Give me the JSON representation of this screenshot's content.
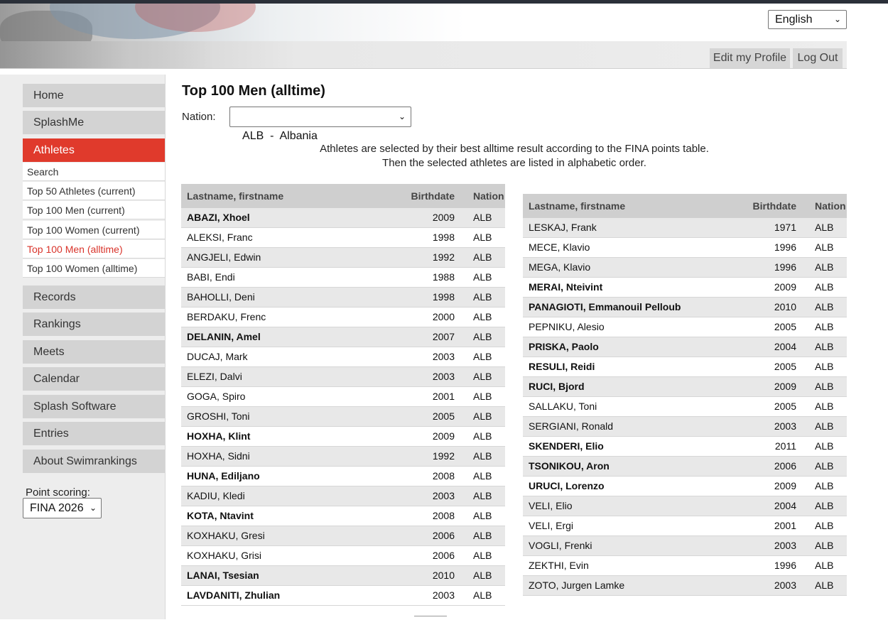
{
  "header": {
    "language": "English",
    "edit_profile": "Edit my Profile",
    "logout": "Log Out"
  },
  "sidebar": {
    "nav_top": [
      {
        "label": "Home",
        "name": "nav-home"
      },
      {
        "label": "SplashMe",
        "name": "nav-splashme"
      },
      {
        "label": "Athletes",
        "name": "nav-athletes",
        "active": true
      }
    ],
    "subitems": [
      {
        "label": "Search",
        "name": "subnav-search"
      },
      {
        "label": "Top 50 Athletes (current)",
        "name": "subnav-top50-current"
      },
      {
        "label": "Top 100 Men (current)",
        "name": "subnav-top100-men-current"
      },
      {
        "label": "Top 100 Women (current)",
        "name": "subnav-top100-women-current"
      },
      {
        "label": "Top 100 Men (alltime)",
        "name": "subnav-top100-men-alltime",
        "current": true
      },
      {
        "label": "Top 100 Women (alltime)",
        "name": "subnav-top100-women-alltime"
      }
    ],
    "nav_bottom": [
      {
        "label": "Records",
        "name": "nav-records"
      },
      {
        "label": "Rankings",
        "name": "nav-rankings"
      },
      {
        "label": "Meets",
        "name": "nav-meets"
      },
      {
        "label": "Calendar",
        "name": "nav-calendar"
      },
      {
        "label": "Splash Software",
        "name": "nav-splash-software"
      },
      {
        "label": "Entries",
        "name": "nav-entries"
      },
      {
        "label": "About Swimrankings",
        "name": "nav-about"
      }
    ],
    "point_scoring_label": "Point scoring:",
    "point_scoring_value": "FINA 2026"
  },
  "main": {
    "title": "Top 100 Men (alltime)",
    "nation_label": "Nation:",
    "nation_value": "ALB  -  Albania",
    "info_line1": "Athletes are selected by their best alltime result according to the FINA points table.",
    "info_line2": "Then the selected athletes are listed in alphabetic order.",
    "columns": {
      "name": "Lastname, firstname",
      "birth": "Birthdate",
      "nation": "Nation"
    },
    "left_table": [
      {
        "name": "ABAZI, Xhoel",
        "birth": "2009",
        "nation": "ALB",
        "bold": true
      },
      {
        "name": "ALEKSI, Franc",
        "birth": "1998",
        "nation": "ALB",
        "bold": false
      },
      {
        "name": "ANGJELI, Edwin",
        "birth": "1992",
        "nation": "ALB",
        "bold": false
      },
      {
        "name": "BABI, Endi",
        "birth": "1988",
        "nation": "ALB",
        "bold": false
      },
      {
        "name": "BAHOLLI, Deni",
        "birth": "1998",
        "nation": "ALB",
        "bold": false
      },
      {
        "name": "BERDAKU, Frenc",
        "birth": "2000",
        "nation": "ALB",
        "bold": false
      },
      {
        "name": "DELANIN, Amel",
        "birth": "2007",
        "nation": "ALB",
        "bold": true
      },
      {
        "name": "DUCAJ, Mark",
        "birth": "2003",
        "nation": "ALB",
        "bold": false
      },
      {
        "name": "ELEZI, Dalvi",
        "birth": "2003",
        "nation": "ALB",
        "bold": false
      },
      {
        "name": "GOGA, Spiro",
        "birth": "2001",
        "nation": "ALB",
        "bold": false
      },
      {
        "name": "GROSHI, Toni",
        "birth": "2005",
        "nation": "ALB",
        "bold": false
      },
      {
        "name": "HOXHA, Klint",
        "birth": "2009",
        "nation": "ALB",
        "bold": true
      },
      {
        "name": "HOXHA, Sidni",
        "birth": "1992",
        "nation": "ALB",
        "bold": false
      },
      {
        "name": "HUNA, Ediljano",
        "birth": "2008",
        "nation": "ALB",
        "bold": true
      },
      {
        "name": "KADIU, Kledi",
        "birth": "2003",
        "nation": "ALB",
        "bold": false
      },
      {
        "name": "KOTA, Ntavint",
        "birth": "2008",
        "nation": "ALB",
        "bold": true
      },
      {
        "name": "KOXHAKU, Gresi",
        "birth": "2006",
        "nation": "ALB",
        "bold": false
      },
      {
        "name": "KOXHAKU, Grisi",
        "birth": "2006",
        "nation": "ALB",
        "bold": false
      },
      {
        "name": "LANAI, Tsesian",
        "birth": "2010",
        "nation": "ALB",
        "bold": true
      },
      {
        "name": "LAVDANITI, Zhulian",
        "birth": "2003",
        "nation": "ALB",
        "bold": true
      }
    ],
    "right_table": [
      {
        "name": "LESKAJ, Frank",
        "birth": "1971",
        "nation": "ALB",
        "bold": false
      },
      {
        "name": "MECE, Klavio",
        "birth": "1996",
        "nation": "ALB",
        "bold": false
      },
      {
        "name": "MEGA, Klavio",
        "birth": "1996",
        "nation": "ALB",
        "bold": false
      },
      {
        "name": "MERAI, Nteivint",
        "birth": "2009",
        "nation": "ALB",
        "bold": true
      },
      {
        "name": "PANAGIOTI, Emmanouil Pelloub",
        "birth": "2010",
        "nation": "ALB",
        "bold": true
      },
      {
        "name": "PEPNIKU, Alesio",
        "birth": "2005",
        "nation": "ALB",
        "bold": false
      },
      {
        "name": "PRISKA, Paolo",
        "birth": "2004",
        "nation": "ALB",
        "bold": true
      },
      {
        "name": "RESULI, Reidi",
        "birth": "2005",
        "nation": "ALB",
        "bold": true
      },
      {
        "name": "RUCI, Bjord",
        "birth": "2009",
        "nation": "ALB",
        "bold": true
      },
      {
        "name": "SALLAKU, Toni",
        "birth": "2005",
        "nation": "ALB",
        "bold": false
      },
      {
        "name": "SERGIANI, Ronald",
        "birth": "2003",
        "nation": "ALB",
        "bold": false
      },
      {
        "name": "SKENDERI, Elio",
        "birth": "2011",
        "nation": "ALB",
        "bold": true
      },
      {
        "name": "TSONIKOU, Aron",
        "birth": "2006",
        "nation": "ALB",
        "bold": true
      },
      {
        "name": "URUCI, Lorenzo",
        "birth": "2009",
        "nation": "ALB",
        "bold": true
      },
      {
        "name": "VELI, Elio",
        "birth": "2004",
        "nation": "ALB",
        "bold": false
      },
      {
        "name": "VELI, Ergi",
        "birth": "2001",
        "nation": "ALB",
        "bold": false
      },
      {
        "name": "VOGLI, Frenki",
        "birth": "2003",
        "nation": "ALB",
        "bold": false
      },
      {
        "name": "ZEKTHI, Evin",
        "birth": "1996",
        "nation": "ALB",
        "bold": false
      },
      {
        "name": "ZOTO, Jurgen Lamke",
        "birth": "2003",
        "nation": "ALB",
        "bold": false
      }
    ]
  }
}
